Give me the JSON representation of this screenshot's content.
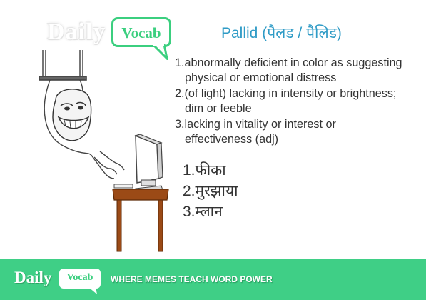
{
  "brand": {
    "daily": "Daily",
    "vocab": "Vocab",
    "accent_color": "#3bcf7f",
    "footer_color": "#3fcf86"
  },
  "word": {
    "headword": "Pallid (पैलड  /  पैलिड)"
  },
  "definitions": [
    {
      "num": "1.",
      "first": "abnormally deficient in color as suggesting",
      "rest": "physical or emotional distress"
    },
    {
      "num": "2.",
      "first": "(of light) lacking in intensity or brightness;",
      "rest": "dim or feeble"
    },
    {
      "num": "3.",
      "first": "lacking in vitality or interest or",
      "rest": "effectiveness (adj)"
    }
  ],
  "hindi_meanings": [
    "1.फीका",
    "2.मुरझाया",
    "3.म्लान"
  ],
  "footer": {
    "daily": "Daily",
    "vocab": "Vocab",
    "tagline": "WHERE MEMES TEACH WORD POWER"
  },
  "icons": [
    "troll-face-icon",
    "computer-monitor-icon",
    "speech-bubble-icon"
  ]
}
